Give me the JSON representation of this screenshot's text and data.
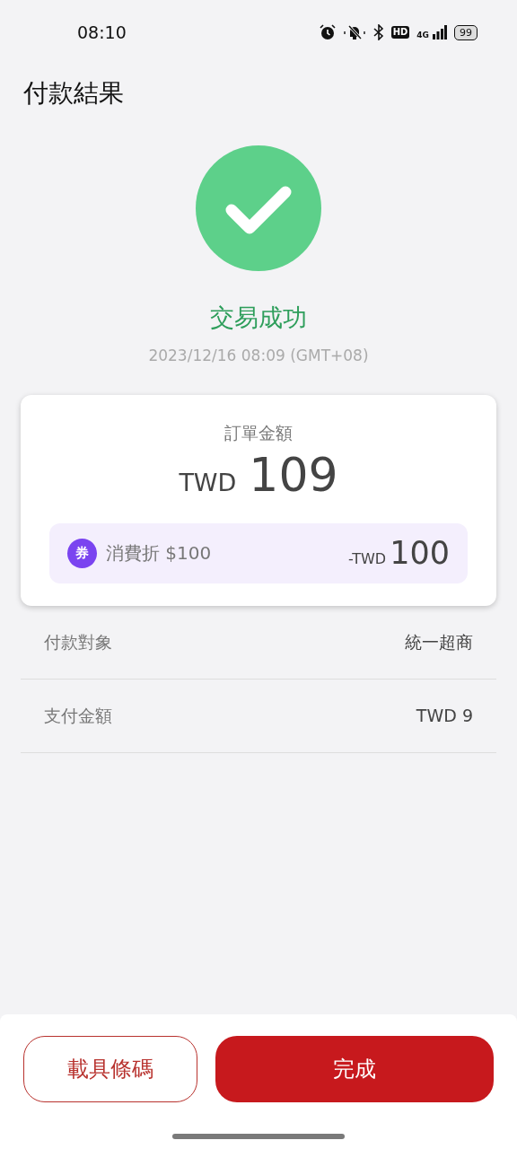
{
  "status_bar": {
    "time": "08:10",
    "hd": "HD",
    "network": "4G",
    "battery": "99"
  },
  "title": "付款結果",
  "result": {
    "status": "交易成功",
    "success": true,
    "datetime": "2023/12/16 08:09 (GMT+08)"
  },
  "order": {
    "label": "訂單金額",
    "currency": "TWD",
    "amount": "109",
    "discount": {
      "badge": "券",
      "name": "消費折 $100",
      "currency": "-TWD",
      "amount": "100"
    }
  },
  "details": [
    {
      "label": "付款對象",
      "value": "統一超商"
    },
    {
      "label": "支付金額",
      "value": "TWD 9"
    }
  ],
  "buttons": [
    {
      "label": "載具條碼",
      "kind": "outline"
    },
    {
      "label": "完成",
      "kind": "primary"
    }
  ]
}
